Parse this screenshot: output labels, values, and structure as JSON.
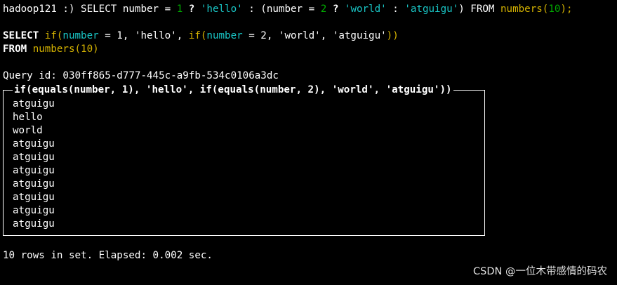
{
  "prompt": {
    "text": "hadoop121 :) SELECT number = ",
    "num1": "1",
    "q1": " ? ",
    "s_hello": "'hello'",
    "colon1": " : (number = ",
    "num2": "2",
    "q2": " ? ",
    "s_world": "'world'",
    "colon2": " : ",
    "s_atguigu": "'atguigu'",
    "close": ") FROM ",
    "fn_numbers": "numbers(",
    "num10": "10",
    "end": ");"
  },
  "rewritten": {
    "select_kw": "SELECT",
    "if1": "if(",
    "number1": "number",
    "eq1": " = 1, 'hello', ",
    "if2": "if(",
    "number2": "number",
    "eq2": " = 2, 'world', 'atguigu'",
    "close": "))",
    "from_kw": "FROM",
    "from_fn": "numbers",
    "from_args": "(10)"
  },
  "query_id": "Query id: 030ff865-d777-445c-a9fb-534c0106a3dc",
  "result": {
    "column_header": "if(equals(number, 1), 'hello', if(equals(number, 2), 'world', 'atguigu'))",
    "rows": [
      "atguigu",
      "hello",
      "world",
      "atguigu",
      "atguigu",
      "atguigu",
      "atguigu",
      "atguigu",
      "atguigu",
      "atguigu"
    ]
  },
  "summary": "10 rows in set. Elapsed: 0.002 sec.",
  "watermark": "CSDN @一位木带感情的码农"
}
